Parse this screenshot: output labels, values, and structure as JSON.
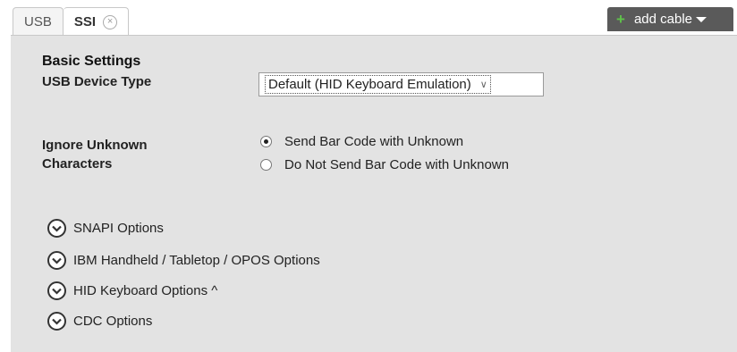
{
  "tabs": [
    {
      "label": "USB"
    },
    {
      "label": "SSI",
      "close_glyph": "×"
    }
  ],
  "add_cable": {
    "plus": "+",
    "label": "add cable"
  },
  "basic_settings": {
    "title": "Basic Settings",
    "usb_device_type": {
      "label": "USB Device Type",
      "selected": "Default (HID Keyboard Emulation)"
    },
    "ignore_unknown": {
      "label_line1": "Ignore Unknown",
      "label_line2": "Characters",
      "options": [
        {
          "label": "Send Bar Code with Unknown",
          "checked": true
        },
        {
          "label": "Do Not Send Bar Code with Unknown",
          "checked": false
        }
      ]
    }
  },
  "accordions": [
    {
      "label": "SNAPI Options",
      "icon": "chevron-down-circle-icon"
    },
    {
      "label": "IBM Handheld / Tabletop / OPOS Options",
      "icon": "chevron-down-circle-icon"
    },
    {
      "label": "HID Keyboard Options ^",
      "icon": "chevron-down-circle-icon"
    },
    {
      "label": "CDC Options",
      "icon": "chevron-down-circle-icon"
    }
  ],
  "colors": {
    "panel_bg": "#e3e3e3",
    "add_cable_bg": "#5a5a5a",
    "plus_green": "#5fc24a"
  }
}
